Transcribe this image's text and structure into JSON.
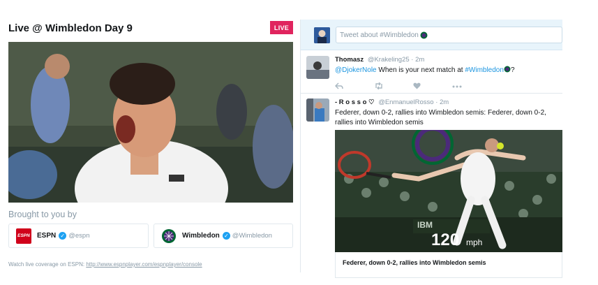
{
  "header": {
    "title": "Live @ Wimbledon Day 9",
    "live_label": "LIVE"
  },
  "sponsors": {
    "heading": "Brought to you by",
    "items": [
      {
        "name": "ESPN",
        "handle": "@espn",
        "logo_text": "ESPN"
      },
      {
        "name": "Wimbledon",
        "handle": "@Wimbledon"
      }
    ]
  },
  "footer": {
    "text": "Watch live coverage on ESPN: ",
    "link": "http://www.espnplayer.com/espnplayer/console"
  },
  "composer": {
    "placeholder": "Tweet about #Wimbledon"
  },
  "tweets": [
    {
      "name": "Thomasz",
      "handle": "@Krakeling25",
      "time": "· 2m",
      "mention": "@DjokerNole",
      "text": " When is your next match at ",
      "hashtag": "#Wimbledon",
      "suffix": "?",
      "actions": [
        "reply-icon",
        "retweet-icon",
        "like-icon",
        "more-icon"
      ]
    },
    {
      "name": "- R o s s o ♡",
      "handle": "@EnmanuelRosso",
      "time": "· 2m",
      "text": "Federer, down 0-2, rallies into Wimbledon semis: Federer, down 0-2, rallies into Wimbledon semis",
      "media": {
        "speed_value": "120",
        "speed_unit": "mph",
        "board_text": "IBM"
      },
      "card_title": "Federer, down 0-2, rallies into Wimbledon semis"
    }
  ],
  "colors": {
    "live": "#e0245e",
    "link": "#1b95e0",
    "verified": "#1da1f2",
    "espn": "#d0021b",
    "wimbledon_purple": "#4b2a7a",
    "wimbledon_green": "#006633"
  }
}
